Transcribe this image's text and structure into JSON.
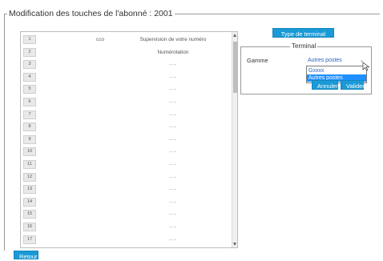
{
  "header": {
    "legend": "Modification des touches de l'abonné : 2001"
  },
  "keys_table": {
    "col_cco": "cco",
    "col_supervision": "Supervision de votre numéro",
    "rows": [
      {
        "key": "1",
        "value": ""
      },
      {
        "key": "2",
        "value": "Numérotation"
      },
      {
        "key": "3",
        "value": "---"
      },
      {
        "key": "4",
        "value": "---"
      },
      {
        "key": "5",
        "value": "---"
      },
      {
        "key": "6",
        "value": "---"
      },
      {
        "key": "7",
        "value": "---"
      },
      {
        "key": "8",
        "value": "---"
      },
      {
        "key": "9",
        "value": "---"
      },
      {
        "key": "10",
        "value": "---"
      },
      {
        "key": "11",
        "value": "---"
      },
      {
        "key": "12",
        "value": "---"
      },
      {
        "key": "13",
        "value": "---"
      },
      {
        "key": "14",
        "value": "---"
      },
      {
        "key": "15",
        "value": "---"
      },
      {
        "key": "16",
        "value": "---"
      },
      {
        "key": "17",
        "value": "---"
      }
    ]
  },
  "type_terminal_button": "Type de terminal",
  "terminal_panel": {
    "legend": "Terminal",
    "gamme_label": "Gamme",
    "select_value": "Autres postes",
    "options": [
      "Gxxxx",
      "Autres postes"
    ],
    "annuler_label": "Annuler",
    "valider_label": "Valider"
  },
  "retour_label": "Retour",
  "colors": {
    "accent": "#1a9ad6",
    "highlight": "#1e90ff"
  }
}
